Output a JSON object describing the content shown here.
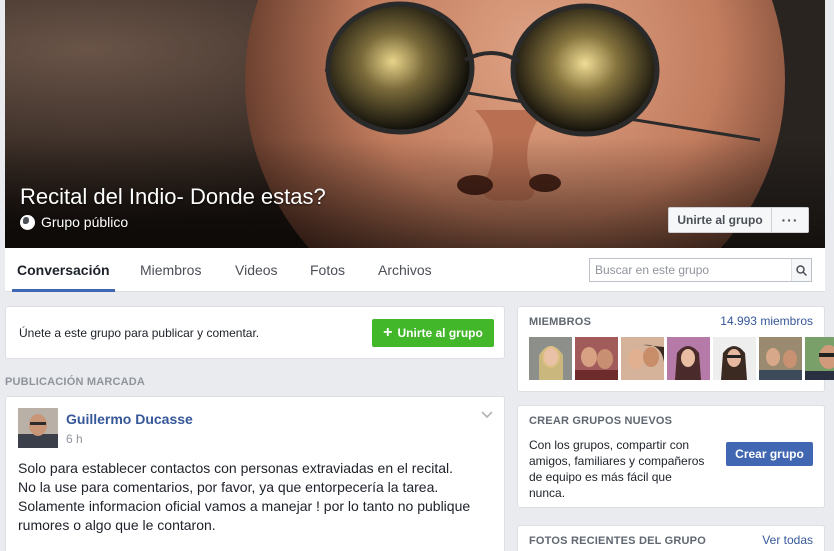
{
  "group": {
    "title": "Recital del Indio- Donde estas?",
    "privacy": "Grupo público",
    "join_button": "Unirte al grupo",
    "more_button": "···"
  },
  "tabs": [
    {
      "label": "Conversación",
      "active": true
    },
    {
      "label": "Miembros"
    },
    {
      "label": "Videos"
    },
    {
      "label": "Fotos"
    },
    {
      "label": "Archivos"
    }
  ],
  "search": {
    "placeholder": "Buscar en este grupo"
  },
  "join_prompt": {
    "text": "Únete a este grupo para publicar y comentar.",
    "button": "Unirte al grupo"
  },
  "pinned": {
    "label": "PUBLICACIÓN MARCADA",
    "author": "Guillermo Ducasse",
    "time": "6 h",
    "lines": [
      "Solo para establecer contactos con personas extraviadas en el recital.",
      "No la use para comentarios, por favor, ya que entorpecería la tarea.",
      "Solamente informacion oficial vamos a manejar ! por lo tanto no publique",
      "rumores o algo que le contaron."
    ]
  },
  "members": {
    "heading": "MIEMBROS",
    "count": "14.993 miembros"
  },
  "create_groups": {
    "heading": "CREAR GRUPOS NUEVOS",
    "text": "Con los grupos, compartir con amigos, familiares y compañeros de equipo es más fácil que nunca.",
    "button": "Crear grupo"
  },
  "recent_photos": {
    "heading": "FOTOS RECIENTES DEL GRUPO",
    "link": "Ver todas"
  },
  "colors": {
    "facebook_blue": "#4267b2",
    "link_blue": "#365899",
    "join_green": "#42b72a",
    "background": "#e9ebee"
  }
}
